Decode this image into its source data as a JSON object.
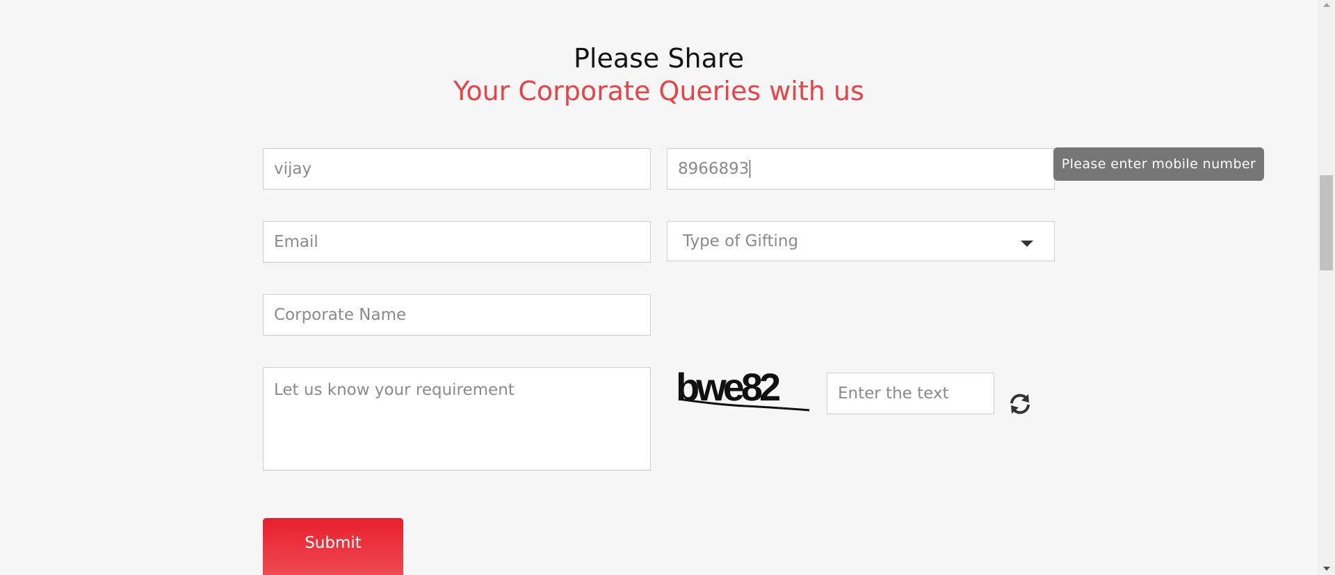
{
  "heading": {
    "line1": "Please Share",
    "line2": "Your Corporate Queries with us"
  },
  "form": {
    "name": {
      "value": "vijay"
    },
    "mobile": {
      "value": "8966893"
    },
    "email": {
      "placeholder": "Email"
    },
    "gifting_type": {
      "selected": "Type of Gifting"
    },
    "corporate_name": {
      "placeholder": "Corporate Name"
    },
    "requirement": {
      "placeholder": "Let us know your requirement"
    },
    "captcha": {
      "image_text": "bwe82",
      "placeholder": "Enter the text"
    },
    "submit_label": "Submit"
  },
  "tooltip": {
    "text": "Please enter mobile number"
  },
  "colors": {
    "accent": "#e84347",
    "button": "#e81f2d",
    "tooltip_bg": "#767676"
  },
  "icons": {
    "refresh": "refresh-icon",
    "dropdown": "chevron-down-icon"
  }
}
